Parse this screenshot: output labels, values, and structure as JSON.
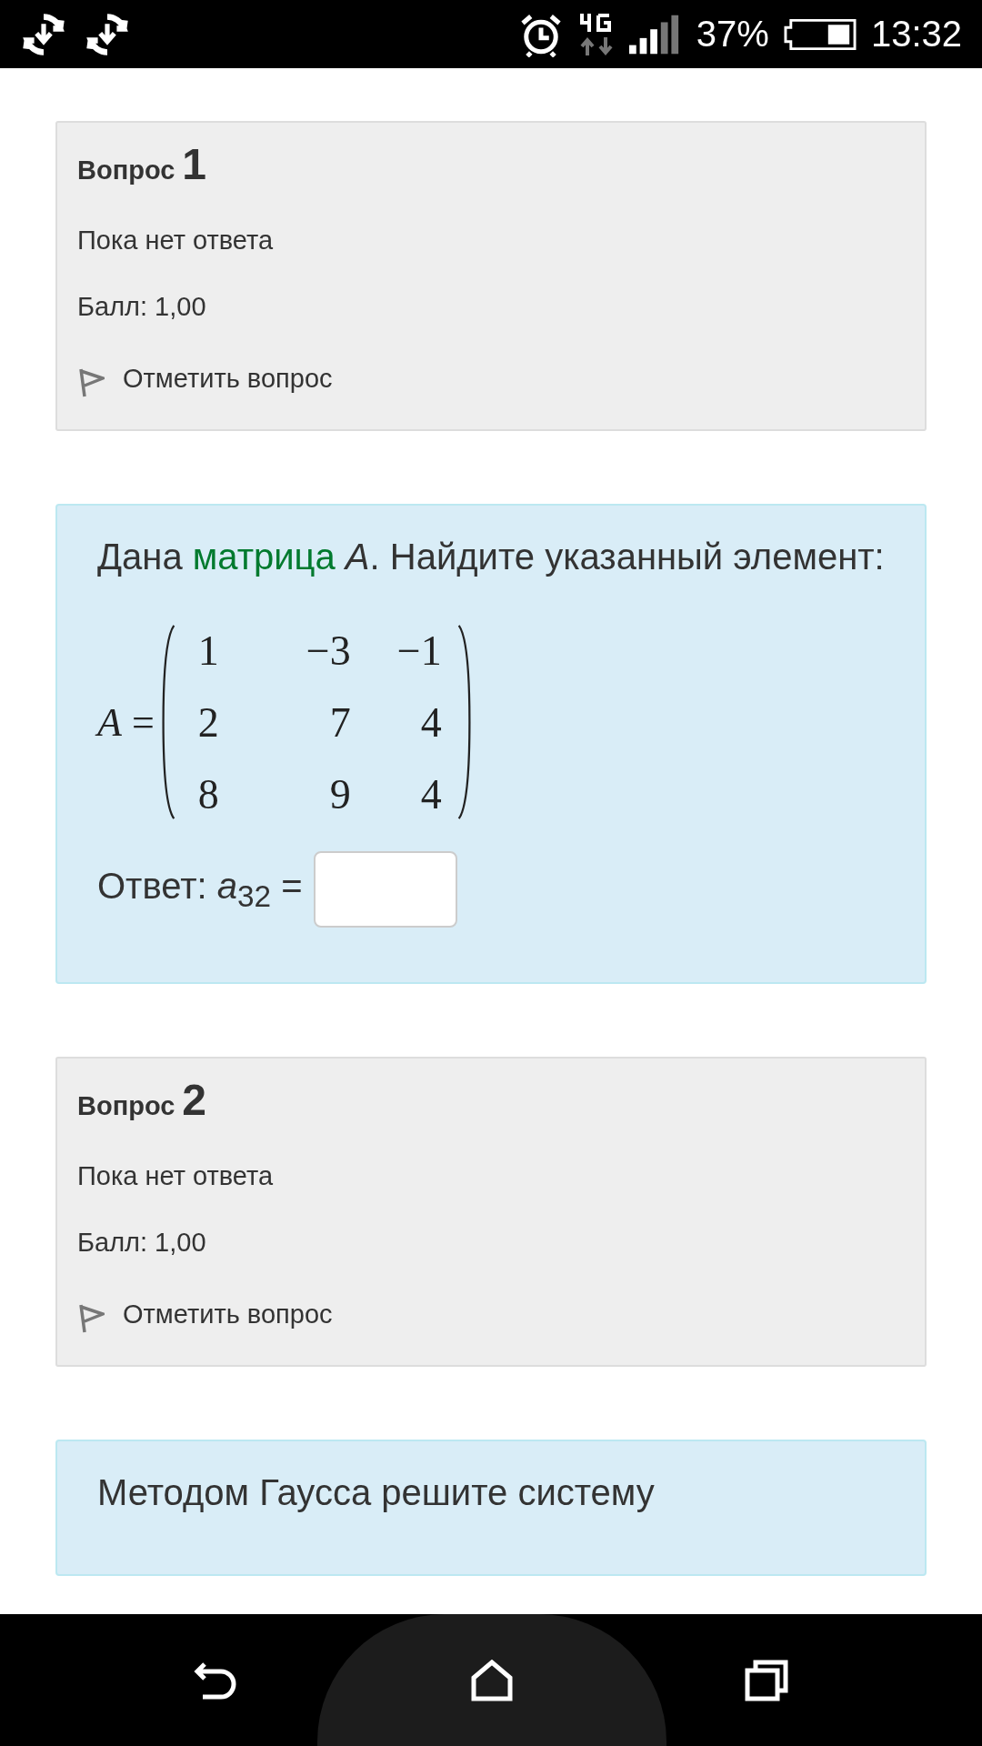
{
  "status_bar": {
    "battery": "37%",
    "time": "13:32"
  },
  "items": [
    {
      "kind": "info",
      "label": "Вопрос",
      "number": "1",
      "status": "Пока нет ответа",
      "grade": "Балл: 1,00",
      "flag": "Отметить вопрос"
    },
    {
      "kind": "question",
      "before": "Дана ",
      "link": "матрица",
      "after": " *A*. Найдите указанный элемент:",
      "matrix_label": "*A* =",
      "matrix": [
        [
          "1",
          "−3",
          "−1"
        ],
        [
          "2",
          "7",
          "4"
        ],
        [
          "8",
          "9",
          "4"
        ]
      ],
      "answer_label": "Ответ: *a*$_{32}$ ="
    },
    {
      "kind": "info",
      "label": "Вопрос",
      "number": "2",
      "status": "Пока нет ответа",
      "grade": "Балл: 1,00",
      "flag": "Отметить вопрос"
    },
    {
      "kind": "question",
      "before": "Методом Гаусса решите систему"
    }
  ]
}
